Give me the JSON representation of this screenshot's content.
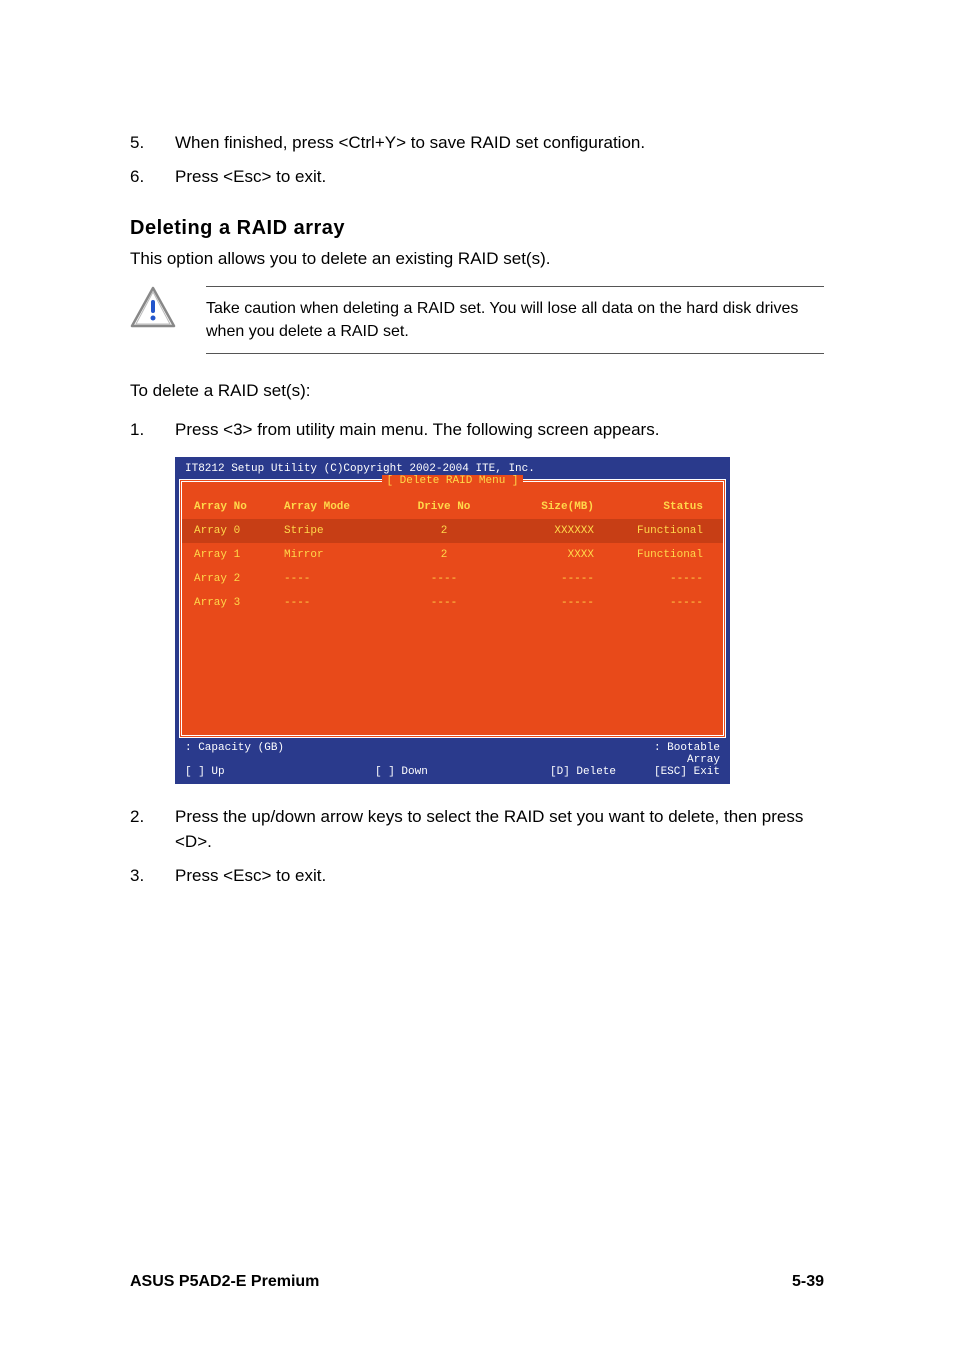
{
  "steps_top": [
    {
      "num": "5.",
      "text": "When finished, press <Ctrl+Y> to save RAID set configuration."
    },
    {
      "num": "6.",
      "text": "Press <Esc> to exit."
    }
  ],
  "section_heading": "Deleting a RAID array",
  "section_intro": "This option allows you to delete an existing RAID set(s).",
  "note_text": "Take caution when deleting a RAID set. You will lose all data on the hard disk drives when you delete a RAID set.",
  "pre_steps_text": "To delete a RAID set(s):",
  "steps_mid": [
    {
      "num": "1.",
      "text": "Press <3> from utility main menu. The following screen appears."
    }
  ],
  "bios": {
    "title": "IT8212 Setup Utility (C)Copyright 2002-2004 ITE, Inc.",
    "menu_title": "[ Delete RAID Menu ]",
    "headers": {
      "c1": "Array No",
      "c2": "Array Mode",
      "c3": "Drive No",
      "c4": "Size(MB)",
      "c5": "Status"
    },
    "rows": [
      {
        "c1": "Array 0",
        "c2": "Stripe",
        "c3": "2",
        "c4": "XXXXXX",
        "c5": "Functional",
        "selected": true
      },
      {
        "c1": "Array 1",
        "c2": "Mirror",
        "c3": "2",
        "c4": "XXXX",
        "c5": "Functional",
        "selected": false
      },
      {
        "c1": "Array 2",
        "c2": "----",
        "c3": "----",
        "c4": "-----",
        "c5": "-----",
        "selected": false
      },
      {
        "c1": "Array 3",
        "c2": "----",
        "c3": "----",
        "c4": "-----",
        "c5": "-----",
        "selected": false
      }
    ],
    "footer": {
      "line1": {
        "f1": "  : Capacity (GB)",
        "f4": ": Bootable Array"
      },
      "line2": {
        "f1": "[ ] Up",
        "f2": "[ ] Down",
        "f3": "[D] Delete",
        "f4": "[ESC] Exit"
      }
    }
  },
  "steps_bottom": [
    {
      "num": "2.",
      "text": "Press the up/down arrow keys to select the RAID set you want to delete, then press <D>."
    },
    {
      "num": "3.",
      "text": "Press <Esc> to exit."
    }
  ],
  "footer_left": "ASUS P5AD2-E Premium",
  "footer_right": "5-39"
}
